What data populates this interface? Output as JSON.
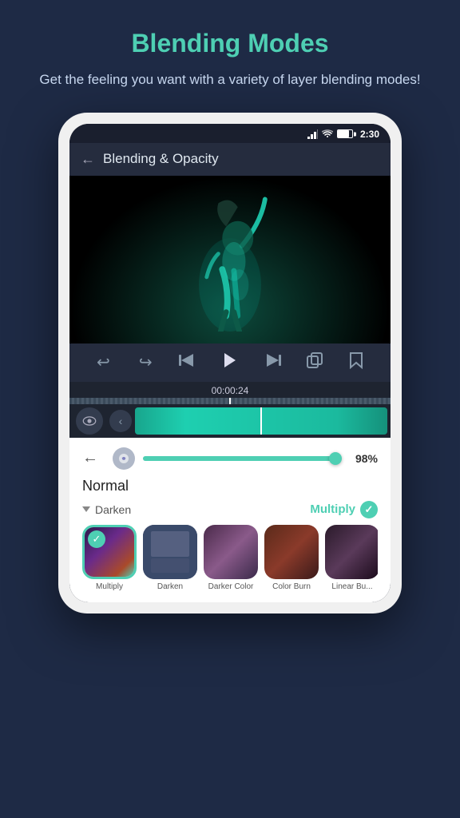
{
  "page": {
    "background_color": "#1e2a45",
    "title": "Blending Modes",
    "subtitle": "Get the feeling you want with a variety of layer blending modes!",
    "title_color": "#4ecfb3",
    "subtitle_color": "#c8d8f0"
  },
  "status_bar": {
    "time": "2:30"
  },
  "app_header": {
    "back_label": "←",
    "title": "Blending & Opacity"
  },
  "video": {
    "timecode": "00:00:24"
  },
  "controls": {
    "undo": "↩",
    "redo": "↪",
    "skip_back": "⏮",
    "play": "▶",
    "skip_forward": "⏭",
    "copy": "⧉",
    "bookmark": "🔖"
  },
  "opacity": {
    "value": "98%",
    "fill_width": "98%"
  },
  "blend": {
    "current_mode": "Normal",
    "group_name": "Darken",
    "group_selected": "Multiply",
    "options": [
      {
        "id": "multiply",
        "label": "Multiply",
        "selected": true
      },
      {
        "id": "darken",
        "label": "Darken",
        "selected": false
      },
      {
        "id": "darker-color",
        "label": "Darker Color",
        "selected": false
      },
      {
        "id": "color-burn",
        "label": "Color Burn",
        "selected": false
      },
      {
        "id": "linear-burn",
        "label": "Linear Bu...",
        "selected": false
      }
    ]
  }
}
